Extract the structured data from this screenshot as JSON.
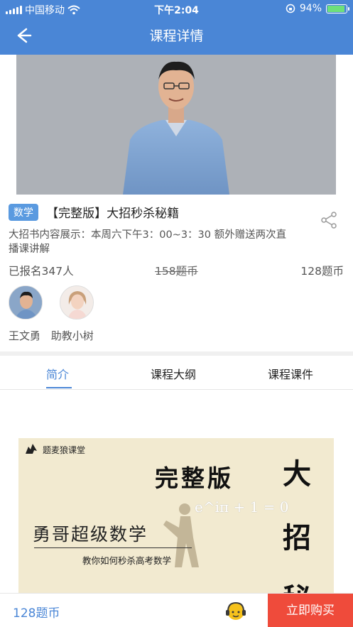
{
  "status_bar": {
    "carrier": "中国移动",
    "time": "下午2:04",
    "battery": "94%",
    "battery_level": 0.94
  },
  "nav": {
    "title": "课程详情",
    "back_icon": "back-arrow-icon"
  },
  "course": {
    "subject_tag": "数学",
    "title": "【完整版】大招秒杀秘籍",
    "description": "大招书内容展示：本周六下午3：00~3：30  额外赠送两次直播课讲解",
    "enrolled": "已报名347人",
    "original_price": "158题币",
    "price": "128题币",
    "share_icon": "share-icon"
  },
  "teachers": [
    {
      "name": "王文勇"
    },
    {
      "name": "助教小树"
    }
  ],
  "tabs": [
    {
      "label": "简介",
      "active": true
    },
    {
      "label": "课程大纲",
      "active": false
    },
    {
      "label": "课程课件",
      "active": false
    }
  ],
  "promo": {
    "brand": "题麦狼课堂",
    "edition": "完整版",
    "formula": "e^iπ + 1 = 0",
    "headline": "勇哥超级数学",
    "subline": "教你如何秒杀高考数学",
    "vertical_chars": [
      "大",
      "招",
      "秘"
    ]
  },
  "bottom_bar": {
    "price": "128题币",
    "buy_label": "立即购买",
    "support_icon": "customer-support-icon"
  },
  "colors": {
    "primary": "#4a86d6",
    "buy": "#ef4b3b",
    "tag": "#5a9ae0"
  }
}
